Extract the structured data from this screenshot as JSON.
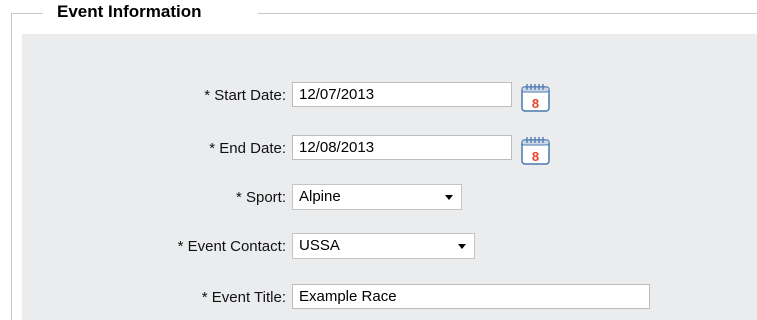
{
  "fieldset": {
    "legend": "Event Information"
  },
  "form": {
    "start_date": {
      "label": "* Start Date:",
      "value": "12/07/2013",
      "calendar_day": "8"
    },
    "end_date": {
      "label": "* End Date:",
      "value": "12/08/2013",
      "calendar_day": "8"
    },
    "sport": {
      "label": "* Sport:",
      "selected": "Alpine"
    },
    "event_contact": {
      "label": "* Event Contact:",
      "selected": "USSA"
    },
    "event_title": {
      "label": "* Event Title:",
      "value": "Example Race"
    }
  },
  "icons": {
    "calendar": "calendar-icon",
    "dropdown": "chevron-down-icon"
  },
  "colors": {
    "panel_bg": "#eaecee",
    "calendar_accent": "#e8452c",
    "calendar_frame": "#4a78b0"
  }
}
